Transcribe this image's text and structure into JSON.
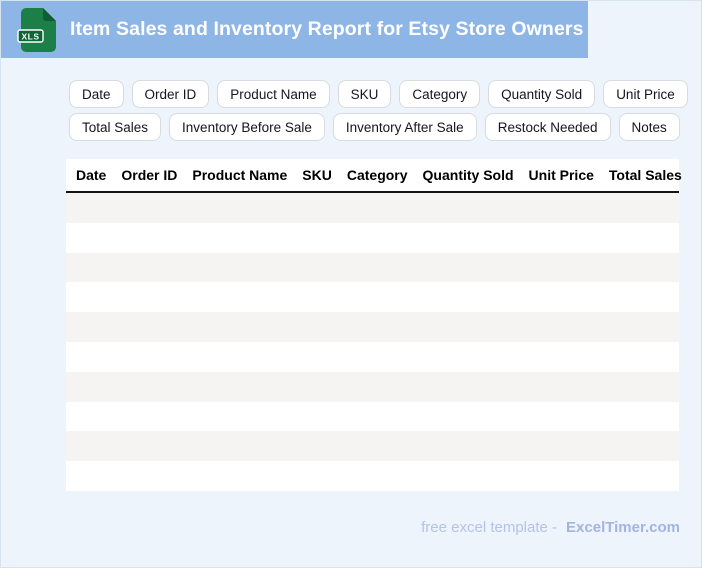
{
  "header": {
    "title": "Item Sales and Inventory Report for Etsy Store Owners",
    "file_badge": "XLS"
  },
  "column_chips": {
    "row1": [
      "Date",
      "Order ID",
      "Product Name",
      "SKU",
      "Category",
      "Quantity Sold",
      "Unit Price"
    ],
    "row2": [
      "Total Sales",
      "Inventory Before Sale",
      "Inventory After Sale",
      "Restock Needed",
      "Notes"
    ]
  },
  "table": {
    "columns": [
      "Date",
      "Order ID",
      "Product Name",
      "SKU",
      "Category",
      "Quantity Sold",
      "Unit Price",
      "Total Sales"
    ],
    "empty_row_count": 10,
    "rows": []
  },
  "footer": {
    "tagline": "free excel template -",
    "brand": "ExcelTimer.com"
  },
  "colors": {
    "banner_blue": "#8db6e6",
    "page_background": "#edf4fc",
    "row_stripe": "#f5f4f3",
    "icon_green": "#1b7f47",
    "icon_green_dark": "#0d5e33",
    "footer_text": "#b5c2e9",
    "footer_brand": "#a3b3e2"
  }
}
